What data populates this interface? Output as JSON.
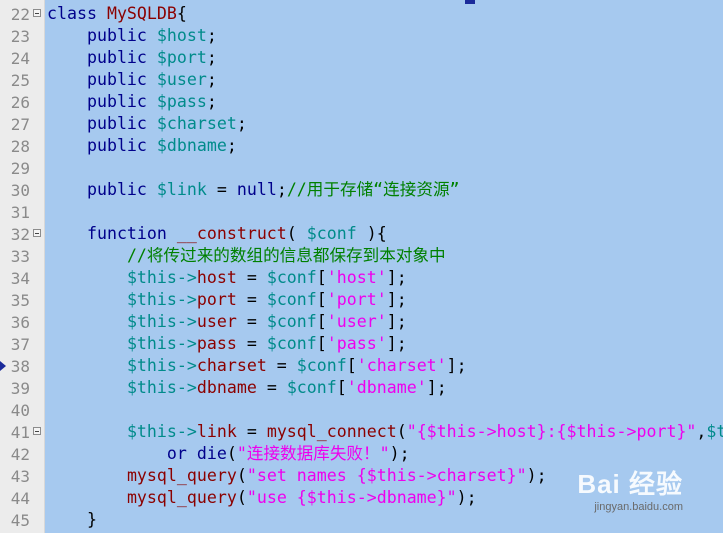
{
  "editor": {
    "lines": [
      {
        "num": "22",
        "fold": true,
        "arrow": false,
        "tokens": [
          [
            "kw",
            "class "
          ],
          [
            "cls",
            "MySQLDB"
          ],
          [
            "op",
            "{"
          ]
        ]
      },
      {
        "num": "23",
        "fold": false,
        "arrow": false,
        "tokens": [
          [
            "op",
            "    "
          ],
          [
            "kw",
            "public "
          ],
          [
            "var",
            "$host"
          ],
          [
            "op",
            ";"
          ]
        ]
      },
      {
        "num": "24",
        "fold": false,
        "arrow": false,
        "tokens": [
          [
            "op",
            "    "
          ],
          [
            "kw",
            "public "
          ],
          [
            "var",
            "$port"
          ],
          [
            "op",
            ";"
          ]
        ]
      },
      {
        "num": "25",
        "fold": false,
        "arrow": false,
        "tokens": [
          [
            "op",
            "    "
          ],
          [
            "kw",
            "public "
          ],
          [
            "var",
            "$user"
          ],
          [
            "op",
            ";"
          ]
        ]
      },
      {
        "num": "26",
        "fold": false,
        "arrow": false,
        "tokens": [
          [
            "op",
            "    "
          ],
          [
            "kw",
            "public "
          ],
          [
            "var",
            "$pass"
          ],
          [
            "op",
            ";"
          ]
        ]
      },
      {
        "num": "27",
        "fold": false,
        "arrow": false,
        "tokens": [
          [
            "op",
            "    "
          ],
          [
            "kw",
            "public "
          ],
          [
            "var",
            "$charset"
          ],
          [
            "op",
            ";"
          ]
        ]
      },
      {
        "num": "28",
        "fold": false,
        "arrow": false,
        "tokens": [
          [
            "op",
            "    "
          ],
          [
            "kw",
            "public "
          ],
          [
            "var",
            "$dbname"
          ],
          [
            "op",
            ";"
          ]
        ]
      },
      {
        "num": "29",
        "fold": false,
        "arrow": false,
        "tokens": []
      },
      {
        "num": "30",
        "fold": false,
        "arrow": false,
        "tokens": [
          [
            "op",
            "    "
          ],
          [
            "kw",
            "public "
          ],
          [
            "var",
            "$link"
          ],
          [
            "op",
            " = "
          ],
          [
            "kw",
            "null"
          ],
          [
            "op",
            ";"
          ],
          [
            "cmt",
            "//用于存储“连接资源”"
          ]
        ]
      },
      {
        "num": "31",
        "fold": false,
        "arrow": false,
        "tokens": []
      },
      {
        "num": "32",
        "fold": true,
        "arrow": false,
        "tokens": [
          [
            "op",
            "    "
          ],
          [
            "kw",
            "function "
          ],
          [
            "fn",
            "__construct"
          ],
          [
            "op",
            "( "
          ],
          [
            "var",
            "$conf"
          ],
          [
            "op",
            " ){"
          ]
        ]
      },
      {
        "num": "33",
        "fold": false,
        "arrow": false,
        "tokens": [
          [
            "op",
            "        "
          ],
          [
            "cmt",
            "//将传过来的数组的信息都保存到本对象中"
          ]
        ]
      },
      {
        "num": "34",
        "fold": false,
        "arrow": false,
        "tokens": [
          [
            "op",
            "        "
          ],
          [
            "var",
            "$this->"
          ],
          [
            "prop",
            "host"
          ],
          [
            "op",
            " = "
          ],
          [
            "var",
            "$conf"
          ],
          [
            "op",
            "["
          ],
          [
            "str",
            "'host'"
          ],
          [
            "op",
            "];"
          ]
        ]
      },
      {
        "num": "35",
        "fold": false,
        "arrow": false,
        "tokens": [
          [
            "op",
            "        "
          ],
          [
            "var",
            "$this->"
          ],
          [
            "prop",
            "port"
          ],
          [
            "op",
            " = "
          ],
          [
            "var",
            "$conf"
          ],
          [
            "op",
            "["
          ],
          [
            "str",
            "'port'"
          ],
          [
            "op",
            "];"
          ]
        ]
      },
      {
        "num": "36",
        "fold": false,
        "arrow": false,
        "tokens": [
          [
            "op",
            "        "
          ],
          [
            "var",
            "$this->"
          ],
          [
            "prop",
            "user"
          ],
          [
            "op",
            " = "
          ],
          [
            "var",
            "$conf"
          ],
          [
            "op",
            "["
          ],
          [
            "str",
            "'user'"
          ],
          [
            "op",
            "];"
          ]
        ]
      },
      {
        "num": "37",
        "fold": false,
        "arrow": false,
        "tokens": [
          [
            "op",
            "        "
          ],
          [
            "var",
            "$this->"
          ],
          [
            "prop",
            "pass"
          ],
          [
            "op",
            " = "
          ],
          [
            "var",
            "$conf"
          ],
          [
            "op",
            "["
          ],
          [
            "str",
            "'pass'"
          ],
          [
            "op",
            "];"
          ]
        ]
      },
      {
        "num": "38",
        "fold": false,
        "arrow": true,
        "tokens": [
          [
            "op",
            "        "
          ],
          [
            "var",
            "$this->"
          ],
          [
            "prop",
            "charset"
          ],
          [
            "op",
            " = "
          ],
          [
            "var",
            "$conf"
          ],
          [
            "op",
            "["
          ],
          [
            "str",
            "'charset'"
          ],
          [
            "op",
            "];"
          ]
        ]
      },
      {
        "num": "39",
        "fold": false,
        "arrow": false,
        "tokens": [
          [
            "op",
            "        "
          ],
          [
            "var",
            "$this->"
          ],
          [
            "prop",
            "dbname"
          ],
          [
            "op",
            " = "
          ],
          [
            "var",
            "$conf"
          ],
          [
            "op",
            "["
          ],
          [
            "str",
            "'dbname'"
          ],
          [
            "op",
            "];"
          ]
        ]
      },
      {
        "num": "40",
        "fold": false,
        "arrow": false,
        "tokens": []
      },
      {
        "num": "41",
        "fold": true,
        "arrow": false,
        "tokens": [
          [
            "op",
            "        "
          ],
          [
            "var",
            "$this->"
          ],
          [
            "prop",
            "link"
          ],
          [
            "op",
            " = "
          ],
          [
            "fn",
            "mysql_connect"
          ],
          [
            "op",
            "("
          ],
          [
            "str",
            "\"{$this->host}:{$this->port}\""
          ],
          [
            "op",
            ","
          ],
          [
            "var",
            "$t"
          ]
        ]
      },
      {
        "num": "42",
        "fold": false,
        "arrow": false,
        "tokens": [
          [
            "op",
            "            "
          ],
          [
            "kw",
            "or "
          ],
          [
            "kw",
            "die"
          ],
          [
            "op",
            "("
          ],
          [
            "str",
            "\"连接数据库失败！\""
          ],
          [
            "op",
            ");"
          ]
        ]
      },
      {
        "num": "43",
        "fold": false,
        "arrow": false,
        "tokens": [
          [
            "op",
            "        "
          ],
          [
            "fn",
            "mysql_query"
          ],
          [
            "op",
            "("
          ],
          [
            "str",
            "\"set names {$this->charset}\""
          ],
          [
            "op",
            ");"
          ]
        ]
      },
      {
        "num": "44",
        "fold": false,
        "arrow": false,
        "tokens": [
          [
            "op",
            "        "
          ],
          [
            "fn",
            "mysql_query"
          ],
          [
            "op",
            "("
          ],
          [
            "str",
            "\"use {$this->dbname}\""
          ],
          [
            "op",
            ");"
          ]
        ]
      },
      {
        "num": "45",
        "fold": false,
        "arrow": false,
        "tokens": [
          [
            "op",
            "    }"
          ]
        ]
      }
    ]
  },
  "watermark": {
    "logo": "Bai 经验",
    "url": "jingyan.baidu.com"
  }
}
